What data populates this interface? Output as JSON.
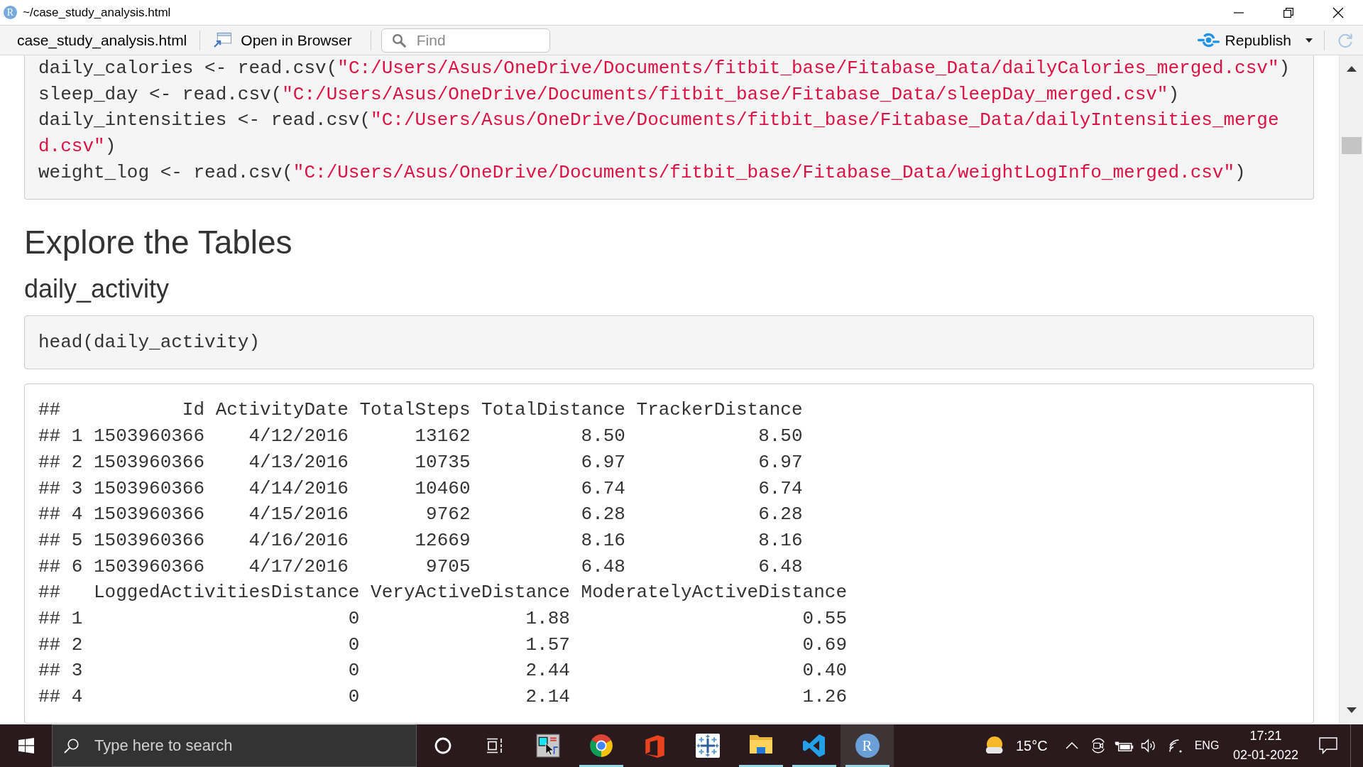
{
  "window": {
    "icon_letter": "R",
    "title": "~/case_study_analysis.html"
  },
  "toolbar": {
    "file_name": "case_study_analysis.html",
    "open_button": "Open in Browser",
    "find": {
      "placeholder": "Find"
    },
    "publish_button": "Republish"
  },
  "document": {
    "blocks": [
      {
        "kind": "code",
        "lines": [
          [
            {
              "kind": "plain",
              "text": "daily_calories <- read.csv("
            },
            {
              "kind": "string",
              "text": "\"C:/Users/Asus/OneDrive/Documents/fitbit_base/Fitabase_Data/dailyCalories_merged.csv\""
            },
            {
              "kind": "plain",
              "text": ")"
            }
          ],
          [
            {
              "kind": "plain",
              "text": "sleep_day <- read.csv("
            },
            {
              "kind": "string",
              "text": "\"C:/Users/Asus/OneDrive/Documents/fitbit_base/Fitabase_Data/sleepDay_merged.csv\""
            },
            {
              "kind": "plain",
              "text": ")"
            }
          ],
          [
            {
              "kind": "plain",
              "text": "daily_intensities <- read.csv("
            },
            {
              "kind": "string",
              "text": "\"C:/Users/Asus/OneDrive/Documents/fitbit_base/Fitabase_Data/dailyIntensities_merged.csv\""
            },
            {
              "kind": "plain",
              "text": ")"
            }
          ],
          [
            {
              "kind": "plain",
              "text": "weight_log <- read.csv("
            },
            {
              "kind": "string",
              "text": "\"C:/Users/Asus/OneDrive/Documents/fitbit_base/Fitabase_Data/weightLogInfo_merged.csv\""
            },
            {
              "kind": "plain",
              "text": ")"
            }
          ]
        ]
      },
      {
        "kind": "heading1",
        "text": "Explore the Tables"
      },
      {
        "kind": "heading2",
        "text": "daily_activity"
      },
      {
        "kind": "code",
        "lines": [
          [
            {
              "kind": "plain",
              "text": "head(daily_activity)"
            }
          ]
        ]
      },
      {
        "kind": "output",
        "lines": [
          "##           Id ActivityDate TotalSteps TotalDistance TrackerDistance",
          "## 1 1503960366    4/12/2016      13162          8.50            8.50",
          "## 2 1503960366    4/13/2016      10735          6.97            6.97",
          "## 3 1503960366    4/14/2016      10460          6.74            6.74",
          "## 4 1503960366    4/15/2016       9762          6.28            6.28",
          "## 5 1503960366    4/16/2016      12669          8.16            8.16",
          "## 6 1503960366    4/17/2016       9705          6.48            6.48",
          "##   LoggedActivitiesDistance VeryActiveDistance ModeratelyActiveDistance",
          "## 1                        0               1.88                     0.55",
          "## 2                        0               1.57                     0.69",
          "## 3                        0               2.44                     0.40",
          "## 4                        0               2.14                     1.26"
        ]
      }
    ]
  },
  "taskbar": {
    "search": {
      "placeholder": "Type here to search"
    },
    "apps": [
      {
        "kind": "snip-tool",
        "running": false,
        "selected": false
      },
      {
        "kind": "chrome",
        "running": true,
        "selected": false
      },
      {
        "kind": "office",
        "running": false,
        "selected": false
      },
      {
        "kind": "cross-grid",
        "running": false,
        "selected": false
      },
      {
        "kind": "folder",
        "running": true,
        "selected": false
      },
      {
        "kind": "code-editor",
        "running": true,
        "selected": false
      },
      {
        "kind": "r-logo",
        "label": "R",
        "running": true,
        "selected": true
      }
    ],
    "temperature": "15°C",
    "language": "ENG",
    "time": "17:21",
    "date": "02-01-2022"
  }
}
